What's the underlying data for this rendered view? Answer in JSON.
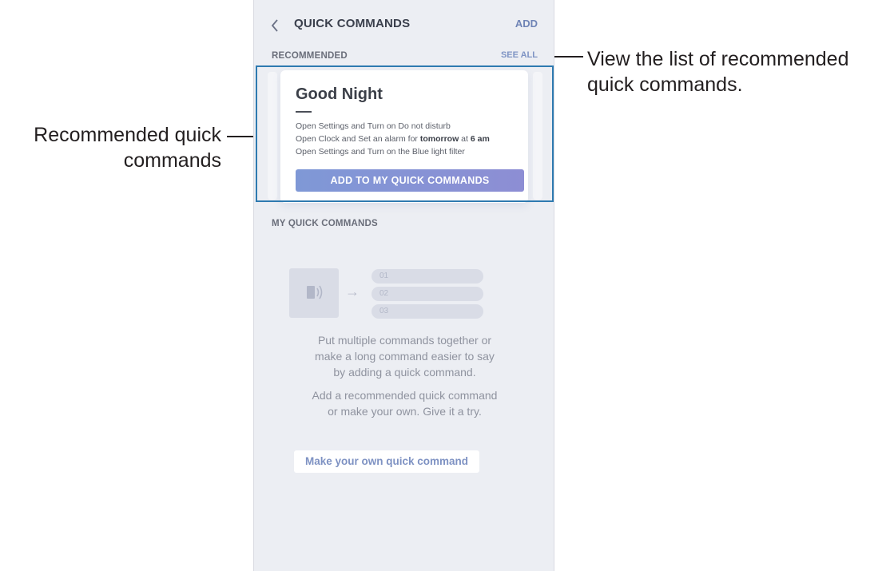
{
  "header": {
    "back_icon": "chevron-left-icon",
    "title": "QUICK COMMANDS",
    "add_label": "ADD"
  },
  "recommended": {
    "label": "RECOMMENDED",
    "see_all": "SEE ALL",
    "card": {
      "title": "Good Night",
      "lines": [
        {
          "text": "Open Settings and Turn on Do not disturb"
        },
        {
          "pre": "Open Clock and Set an alarm for ",
          "bold1": "tomorrow",
          "mid": " at ",
          "bold2": "6 am"
        },
        {
          "text": "Open Settings and Turn on the Blue light filter"
        }
      ],
      "button": "ADD TO MY QUICK COMMANDS"
    }
  },
  "my_quick_commands": {
    "label": "MY QUICK COMMANDS",
    "illustration": {
      "icon": "voice-phone-icon",
      "arrow": "→",
      "steps": [
        "01",
        "02",
        "03"
      ]
    },
    "description1": [
      "Put multiple commands together or",
      "make a long command easier to say",
      "by adding a quick command."
    ],
    "description2": [
      "Add a recommended quick command",
      "or make your own. Give it a try."
    ],
    "make_own_button": "Make your own quick command"
  },
  "callouts": {
    "left": [
      "Recommended quick",
      "commands"
    ],
    "right": [
      "View the list of recommended",
      "quick commands."
    ]
  },
  "colors": {
    "accent": "#7f94c4",
    "highlight": "#2e7ab0",
    "screen_bg": "#eceef3"
  }
}
